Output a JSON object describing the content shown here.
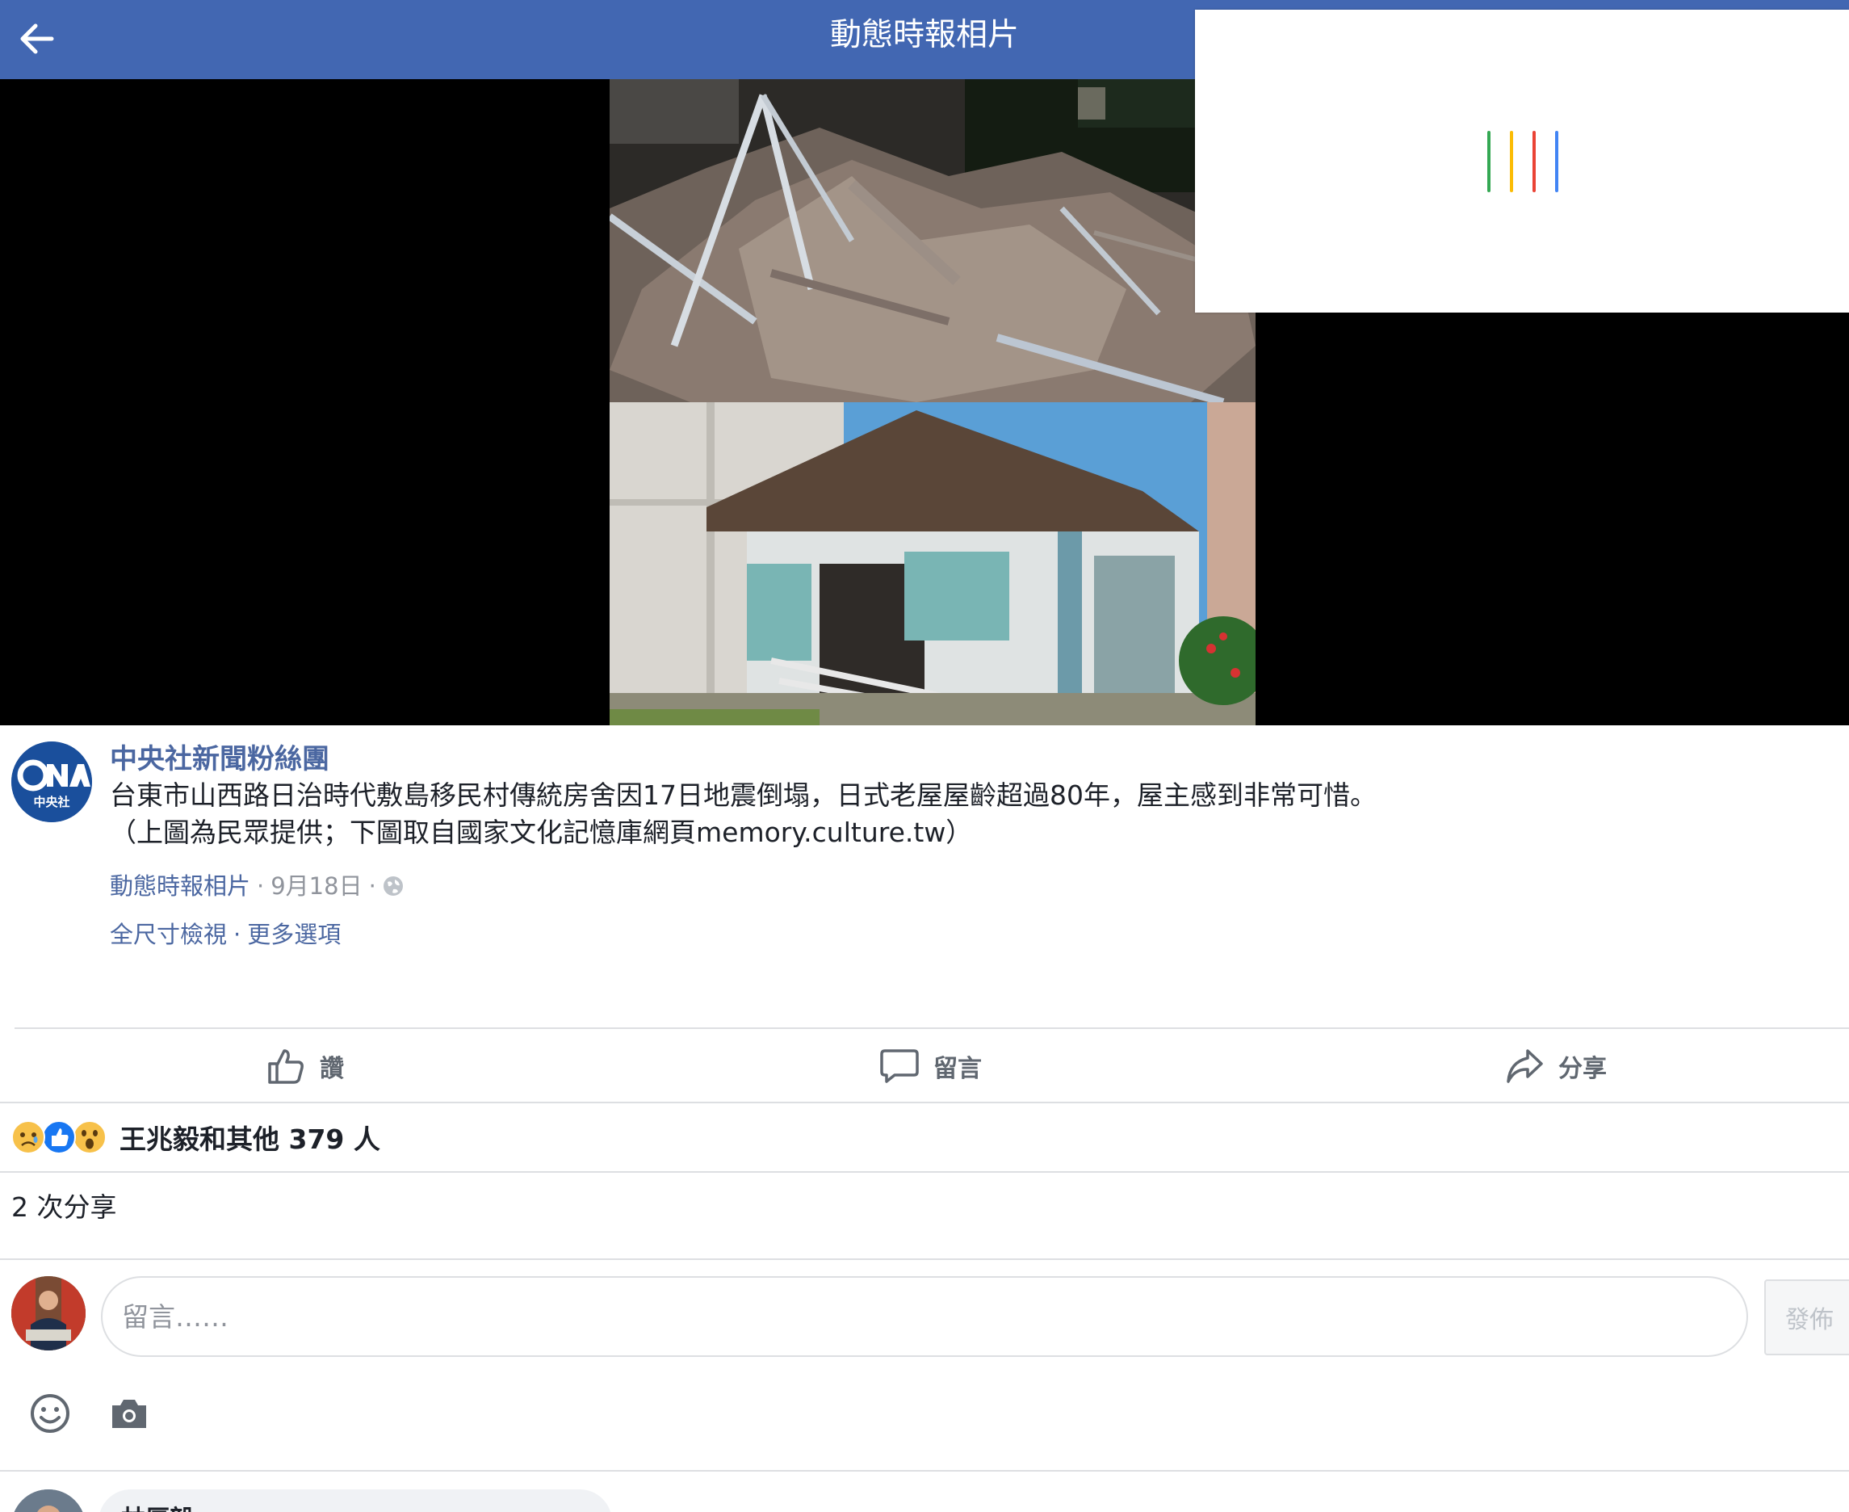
{
  "header": {
    "title": "動態時報相片",
    "back_icon": "back-arrow-icon"
  },
  "overlay": {
    "bar_colors": [
      "#34a853",
      "#fbbc05",
      "#ea4335",
      "#4285f4"
    ]
  },
  "post": {
    "page_name": "中央社新聞粉絲團",
    "avatar_text": "中央社",
    "caption_line1": "台東市山西路日治時代敷島移民村傳統房舍因17日地震倒塌，日式老屋屋齡超過80年，屋主感到非常可惜。",
    "caption_line2": "（上圖為民眾提供；下圖取自國家文化記憶庫網頁memory.culture.tw）",
    "album": "動態時報相片",
    "date": "9月18日",
    "privacy_icon": "globe-icon",
    "view_full_size": "全尺寸檢視",
    "more_options": "更多選項"
  },
  "actions": {
    "like": "讚",
    "comment": "留言",
    "share": "分享"
  },
  "reactions": {
    "icons": [
      "sad-reaction-icon",
      "like-reaction-icon",
      "wow-reaction-icon"
    ],
    "summary": "王兆毅和其他 379 人"
  },
  "shares": {
    "count_text": "2 次分享"
  },
  "composer": {
    "placeholder": "留言……",
    "post_label": "發佈"
  },
  "next_comment": {
    "author": "林厚毅"
  },
  "colors": {
    "header_bg": "#4267b2",
    "link": "#4b67a1"
  }
}
